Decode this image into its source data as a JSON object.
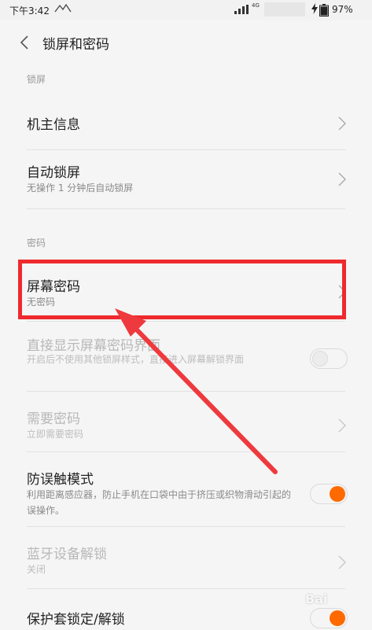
{
  "status_bar": {
    "time": "下午3:42",
    "notification": "",
    "network": "4G",
    "battery_percent": "97%",
    "battery_level": 0.97
  },
  "header": {
    "title": "锁屏和密码"
  },
  "sections": {
    "lockscreen_header": "锁屏",
    "password_header": "密码"
  },
  "items": {
    "owner_info": {
      "label": "机主信息"
    },
    "auto_lock": {
      "label": "自动锁屏",
      "sub": "无操作 1 分钟后自动锁屏"
    },
    "screen_password": {
      "label": "屏幕密码",
      "sub": "无密码"
    },
    "direct_show": {
      "label": "直接显示屏幕密码界面",
      "sub": "开启后不使用其他锁屏样式，直接进入屏幕解锁界面",
      "enabled": false
    },
    "require_password": {
      "label": "需要密码",
      "sub": "立即需要密码"
    },
    "anti_mistouch": {
      "label": "防误触模式",
      "sub": "利用距离感应器，防止手机在口袋中由于挤压或织物滑动引起的误操作。",
      "enabled": true
    },
    "bluetooth_unlock": {
      "label": "蓝牙设备解锁",
      "sub": "关闭"
    },
    "case_lock": {
      "label": "保护套锁定/解锁"
    }
  },
  "colors": {
    "accent": "#ff6a00",
    "annotation": "#ee2a2e"
  },
  "watermark": "Bai"
}
